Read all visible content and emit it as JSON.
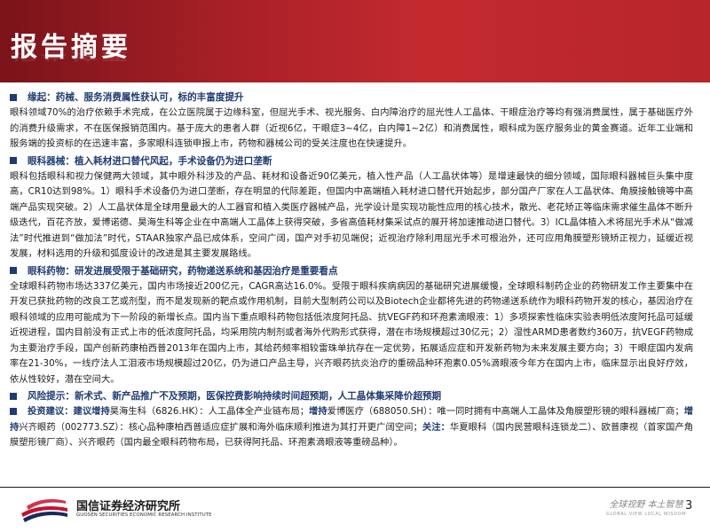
{
  "header": {
    "title": "报告摘要"
  },
  "sections": [
    {
      "label": "缘起：药械、服务消费属性获认可，标的丰富度提升",
      "body": "眼科领域70%的治疗依赖手术完成，在公立医院属于边缘科室，但屈光手术、视光服务、白内障治疗的屈光性人工晶体、干眼症治疗等均有强消费属性，属于基础医疗外的消费升级需求，不在医保报销范围内。基于庞大的患者人群（近视6亿，干眼症3~4亿，白内障1~2亿）和消费属性，眼科成为医疗服务业的黄金赛道。近年工业端和服务端的投资标的在迅速丰富，多家眼科连锁申报上市，药物和器械公司的受关注度也在快速提升。"
    },
    {
      "label": "眼科器械：植入耗材进口替代风起，手术设备仍为进口垄断",
      "body": "眼科包括眼科和视力保健两大领域，其中眼外科涉及的产品、耗材和设备近90亿美元，植入性产品（人工晶状体等）是增速最快的细分领域，国际眼科器械巨头集中度高，CR10达到98%。1）眼科手术设备仍为进口垄断，存在明显的代际差距，但国内中高端植入耗材进口替代开始起步，部分国产厂家在人工晶状体、角膜接触镜等中高端产品实现突破。2）人工晶状体是全球用量最大的人工器官和植入类医疗器械产品，光学设计是实现功能性应用的核心技术，散光、老花矫正等临床需求催生晶体不断升级迭代，百花齐放，爱博诺德、昊海生科等企业在中高端人工晶体上获得突破，多省高值耗材集采试点的展开将加速推动进口替代。3）ICL晶体植入术将屈光手术从“做减法”时代推进到“做加法”时代，STAAR独家产品已成体系，空间广阔，国产对手初见端倪；近视治疗除利用屈光手术可根治外，还可应用角膜塑形镜矫正视力，延缓近视发展，材料选用的升级和弧度设计的改进是其主要发展路线。"
    },
    {
      "label": "眼科药物：研发进展受限于基础研究，药物递送系统和基因治疗是重要看点",
      "body": "全球眼科药物市场达337亿美元，国内市场接近200亿元，CAGR高达16.0%。受限于眼科疾病病因的基础研究进展缓慢，全球眼科制药企业的药物研发工作主要集中在开发已获批药物的改良工艺或剂型，而不是发现新的靶点或作用机制，目前大型制药公司以及Biotech企业都将先进的药物递送系统作为眼科药物开发的核心，基因治疗在眼科领域的应用可能成为下一阶段的新增长点。国内当下重点眼科药物包括低浓度阿托品、抗VEGF药和环孢素滴眼液：1）多项探索性临床实验表明低浓度阿托品可延缓近视进程，国内目前没有正式上市的低浓度阿托品，均采用院内制剂或者海外代购形式获得，潜在市场规模超过30亿元；2）湿性ARMD患者数约360万，抗VEGF药物成为主要治疗手段，国产创新药康柏西普2013年在国内上市，其给药频率相较雷珠单抗存在一定优势，拓展适应症和开发新药物为未来发展主要方向；3）干眼症国内发病率在21-30%，一线疗法人工泪液市场规模超过20亿，仍为进口产品主导，兴齐眼药抗炎治疗的重磅品种环孢素0.05%滴眼液今年方在国内上市，临床显示出良好疗效，依从性较好，潜在空间大。"
    },
    {
      "label": "风险提示：",
      "label_body": "新术式、新产品推广不及预期，医保控费影响持续时间超预期，人工晶体集采降价超预期"
    }
  ],
  "investment": {
    "label": "投资建议：",
    "segments": [
      {
        "text": "建议增持",
        "bold": true
      },
      {
        "text": "昊海生科（6826.HK）：人工晶体全产业链布局；",
        "bold": false
      },
      {
        "text": "增持",
        "bold": true
      },
      {
        "text": "爱博医疗（688050.SH）：唯一同时拥有中高端人工晶体及角膜塑形镜的眼科器械厂商；",
        "bold": false
      },
      {
        "text": "增持",
        "bold": true
      },
      {
        "text": "兴齐眼药（002773.SZ）：核心品种康柏西普适应症扩展和海外临床顺利推进为其打开更广阔空间；",
        "bold": false
      },
      {
        "text": "关注：",
        "bold": true
      },
      {
        "text": "华夏眼科（国内民营眼科连锁龙二）、欧普康视（首家国产角膜塑形镜厂商）、兴齐眼药（国内最全眼科药物布局，已获得阿托品、环孢素滴眼液等重磅品种）。",
        "bold": false
      }
    ]
  },
  "footer": {
    "logo_cn": "国信证券经济研究所",
    "logo_en": "GUOSEN SECURITIES ECONOMIC RESEARCH INSTITUTE",
    "slogan_cn": "全球视野 本土智慧",
    "slogan_en": "GLOBAL VIEW LOCAL WISDOM",
    "page_number": "3"
  },
  "colors": {
    "header_red": "#b8252a",
    "accent_navy": "#1f3b73",
    "logo_red": "#c8102e",
    "logo_navy": "#1a2a5e"
  }
}
